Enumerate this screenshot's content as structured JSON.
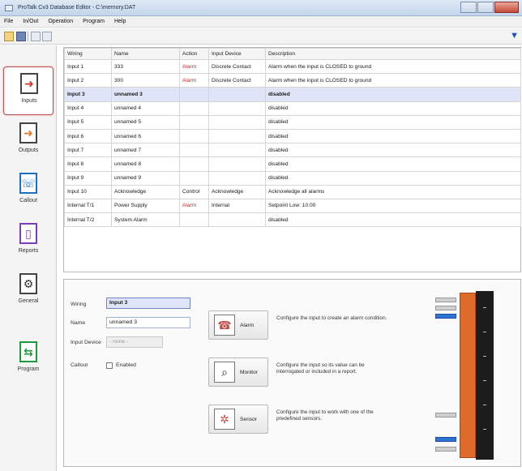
{
  "window": {
    "title": "ProTalk Cv3 Database Editor - C:\\memory.DAT"
  },
  "menu": {
    "items": [
      "File",
      "In/Out",
      "Operation",
      "Program",
      "Help"
    ]
  },
  "toolbar": {
    "right_icon": "filter-icon"
  },
  "nav": {
    "items": [
      {
        "label": "Inputs",
        "icon": "arrow-right-icon",
        "active": true
      },
      {
        "label": "Outputs",
        "icon": "arrow-out-icon",
        "active": false
      },
      {
        "label": "Callout",
        "icon": "callout-icon",
        "active": false
      },
      {
        "label": "Reports",
        "icon": "report-icon",
        "active": false
      },
      {
        "label": "General",
        "icon": "gear-icon",
        "active": false
      },
      {
        "label": "Program",
        "icon": "transfer-icon",
        "active": false
      }
    ]
  },
  "table": {
    "headers": [
      "Wiring",
      "Name",
      "Action",
      "Input Device",
      "Description"
    ],
    "rows": [
      [
        "Input 1",
        "333",
        "Alarm",
        "Discrete Contact",
        "Alarm when the input is CLOSED to ground"
      ],
      [
        "Input 2",
        "300",
        "Alarm",
        "Discrete Contact",
        "Alarm when the input is CLOSED to ground"
      ],
      [
        "Input 3",
        "unnamed 3",
        "",
        "",
        "disabled"
      ],
      [
        "Input 4",
        "unnamed 4",
        "",
        "",
        "disabled"
      ],
      [
        "Input 5",
        "unnamed 5",
        "",
        "",
        "disabled"
      ],
      [
        "Input 6",
        "unnamed 6",
        "",
        "",
        "disabled"
      ],
      [
        "Input 7",
        "unnamed 7",
        "",
        "",
        "disabled"
      ],
      [
        "Input 8",
        "unnamed 8",
        "",
        "",
        "disabled"
      ],
      [
        "Input 9",
        "unnamed 9",
        "",
        "",
        "disabled"
      ],
      [
        "Input 10",
        "Acknowledge",
        "Control",
        "Acknowledge",
        "Acknowledge all alarms"
      ],
      [
        "Internal T/1",
        "Power Supply",
        "Alarm",
        "Internal",
        "Setpoint Low: 10.00"
      ],
      [
        "Internal T/2",
        "System Alarm",
        "",
        "",
        "disabled"
      ]
    ],
    "selected_row": 2
  },
  "detail": {
    "wiring_label": "Wiring",
    "wiring_value": "Input 3",
    "name_label": "Name",
    "name_value": "unnamed 3",
    "input_device_label": "Input Device",
    "input_device_value": "- none -",
    "callout_label": "Callout",
    "enabled_label": "Enabled",
    "modes": [
      {
        "label": "Alarm",
        "icon": "alarm-icon",
        "description": "Configure the input to create an alarm condition."
      },
      {
        "label": "Monitor",
        "icon": "binoculars-icon",
        "description": "Configure the input so its value can be interrogated or included in a report."
      },
      {
        "label": "Sensor",
        "icon": "sensor-icon",
        "description": "Configure the input to work with one of the predefined sensors."
      }
    ]
  }
}
